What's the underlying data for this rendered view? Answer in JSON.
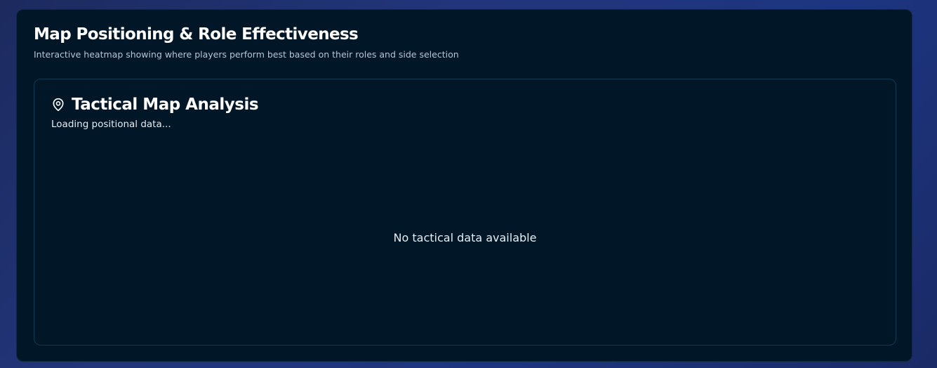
{
  "section": {
    "title": "Map Positioning & Role Effectiveness",
    "subtitle": "Interactive heatmap showing where players perform best based on their roles and side selection"
  },
  "tactical_card": {
    "icon": "map-pin-icon",
    "title": "Tactical Map Analysis",
    "status": "Loading positional data...",
    "empty_message": "No tactical data available"
  },
  "colors": {
    "page_background": "#1d3580",
    "card_background": "#011627",
    "inner_border": "#0f3a52",
    "title_text": "#ffffff",
    "subtitle_text": "#b9c4d6"
  }
}
